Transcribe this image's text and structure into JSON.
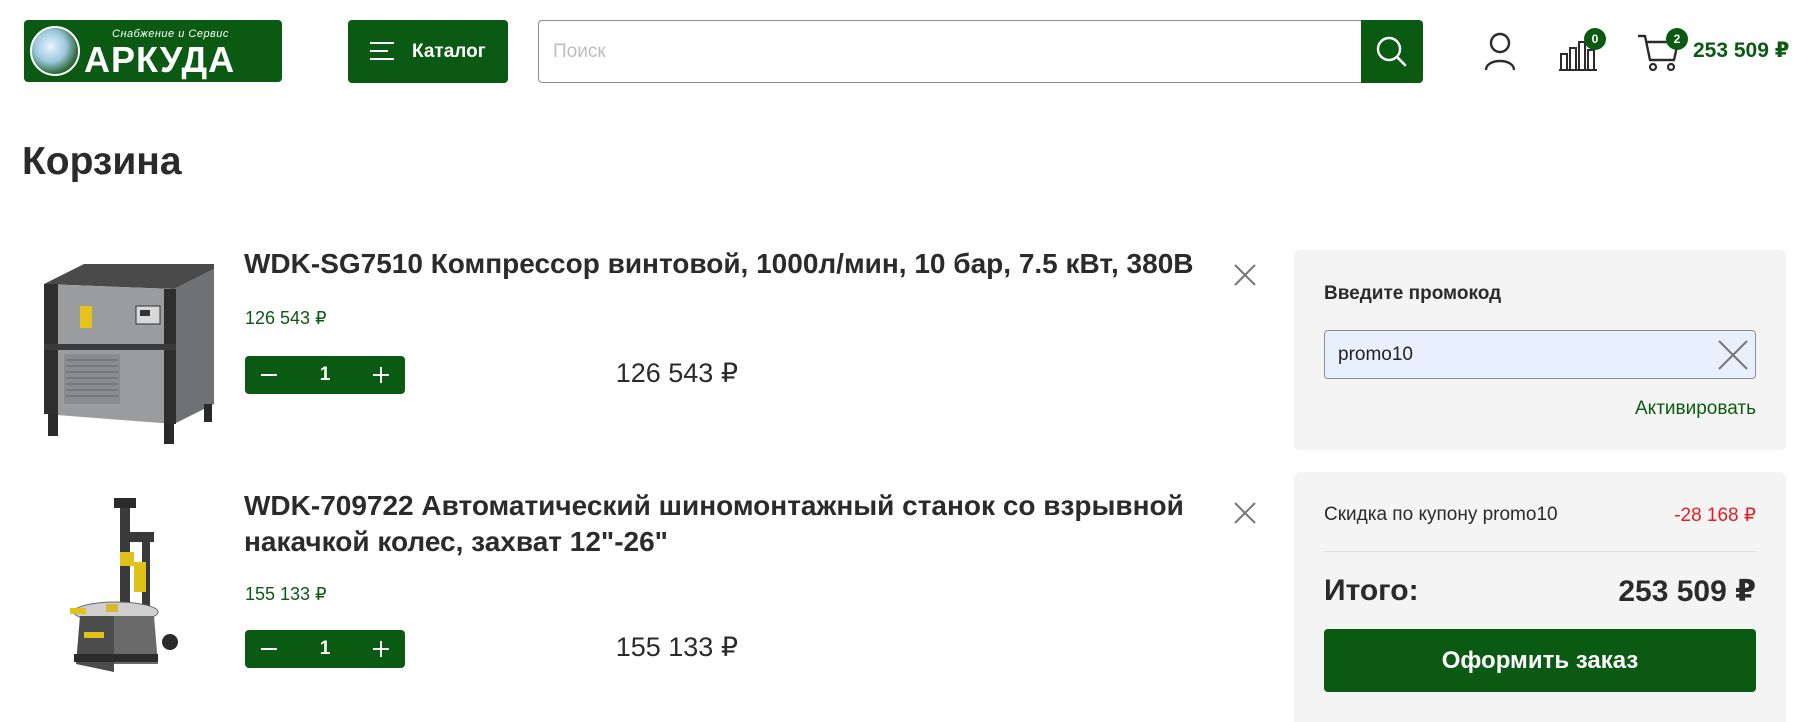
{
  "header": {
    "logo": {
      "subtitle": "Снабжение и Сервис",
      "name": "АРКУДА"
    },
    "catalog_label": "Каталог",
    "search": {
      "placeholder": "Поиск",
      "value": ""
    },
    "compare_count": "0",
    "cart_count": "2",
    "cart_total": "253 509 ₽",
    "icons": {
      "menu": "burger-menu-icon",
      "search": "search-icon",
      "user": "user-icon",
      "compare": "compare-chart-icon",
      "cart": "cart-icon"
    }
  },
  "page": {
    "title": "Корзина"
  },
  "cart": {
    "items": [
      {
        "name": "WDK-SG7510 Компрессор винтовой, 1000л/мин, 10 бар, 7.5 кВт, 380В",
        "unit_price": "126 543 ₽",
        "quantity": "1",
        "total": "126 543 ₽"
      },
      {
        "name": "WDK-709722 Автоматический шиномонтажный станок со взрывной накачкой колес, захват 12\"-26\"",
        "unit_price": "155 133 ₽",
        "quantity": "1",
        "total": "155 133 ₽"
      }
    ]
  },
  "promo": {
    "label": "Введите промокод",
    "value": "promo10",
    "activate_label": "Активировать"
  },
  "summary": {
    "discount_label": "Скидка по купону promo10",
    "discount_value": "-28 168 ₽",
    "total_label": "Итого:",
    "total_value": "253 509 ₽",
    "checkout_label": "Оформить заказ"
  },
  "colors": {
    "brand": "#0b5a13",
    "discount": "#e31e24",
    "panel": "#f4f4f4",
    "promo_input_bg": "#e8f0fd"
  }
}
